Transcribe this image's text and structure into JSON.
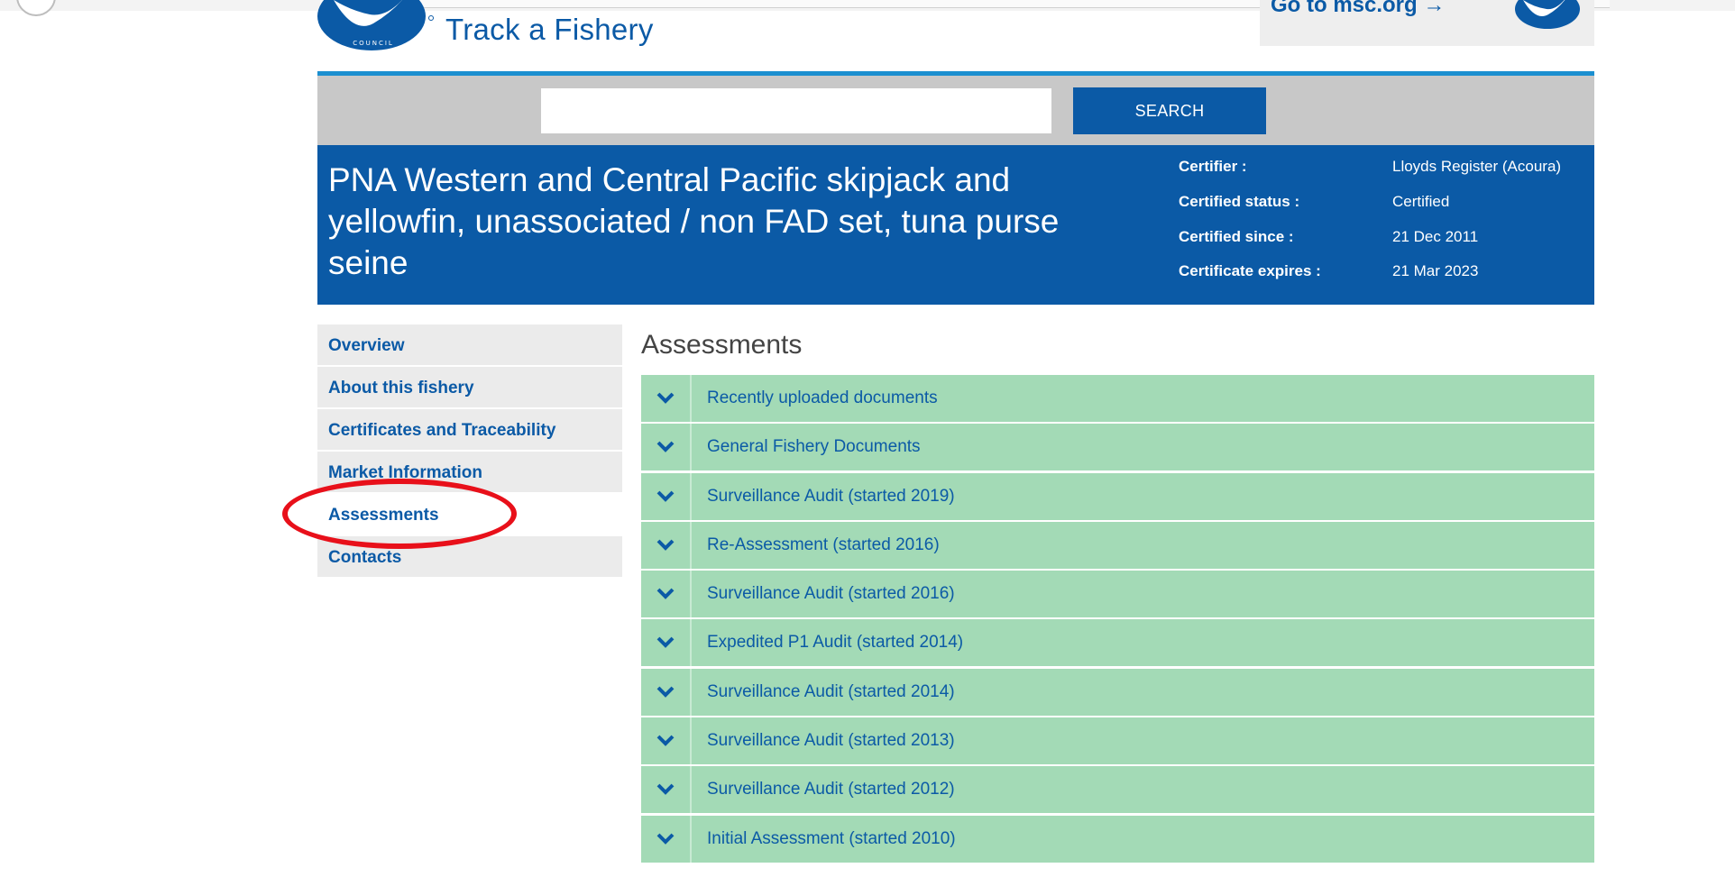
{
  "header": {
    "site_title": "Track a Fishery",
    "goto_link": "Go to msc.org →",
    "logo_icon": "msc-logo-icon"
  },
  "search": {
    "placeholder": "",
    "value": "",
    "button_label": "SEARCH"
  },
  "fishery": {
    "title": "PNA Western and Central Pacific skipjack and yellowfin, unassociated / non FAD set, tuna purse seine",
    "details": [
      {
        "label": "Certifier :",
        "value": "Lloyds Register (Acoura)"
      },
      {
        "label": "Certified status :",
        "value": "Certified"
      },
      {
        "label": "Certified since :",
        "value": "21 Dec 2011"
      },
      {
        "label": "Certificate expires :",
        "value": "21 Mar 2023"
      }
    ]
  },
  "sidenav": {
    "items": [
      {
        "label": "Overview",
        "active": false
      },
      {
        "label": "About this fishery",
        "active": false
      },
      {
        "label": "Certificates and Traceability",
        "active": false
      },
      {
        "label": "Market Information",
        "active": false
      },
      {
        "label": "Assessments",
        "active": true
      },
      {
        "label": "Contacts",
        "active": false
      }
    ]
  },
  "main": {
    "heading": "Assessments",
    "accordion": [
      "Recently uploaded documents",
      "General Fishery Documents",
      "Surveillance Audit (started 2019)",
      "Re-Assessment (started 2016)",
      "Surveillance Audit (started 2016)",
      "Expedited P1 Audit (started 2014)",
      "Surveillance Audit (started 2014)",
      "Surveillance Audit (started 2013)",
      "Surveillance Audit (started 2012)",
      "Initial Assessment (started 2010)"
    ]
  },
  "colors": {
    "brand_blue": "#0b5aa6",
    "accent_rule": "#1b8fd0",
    "accordion_green": "#a3dab6",
    "annotation_red": "#e8101a"
  }
}
